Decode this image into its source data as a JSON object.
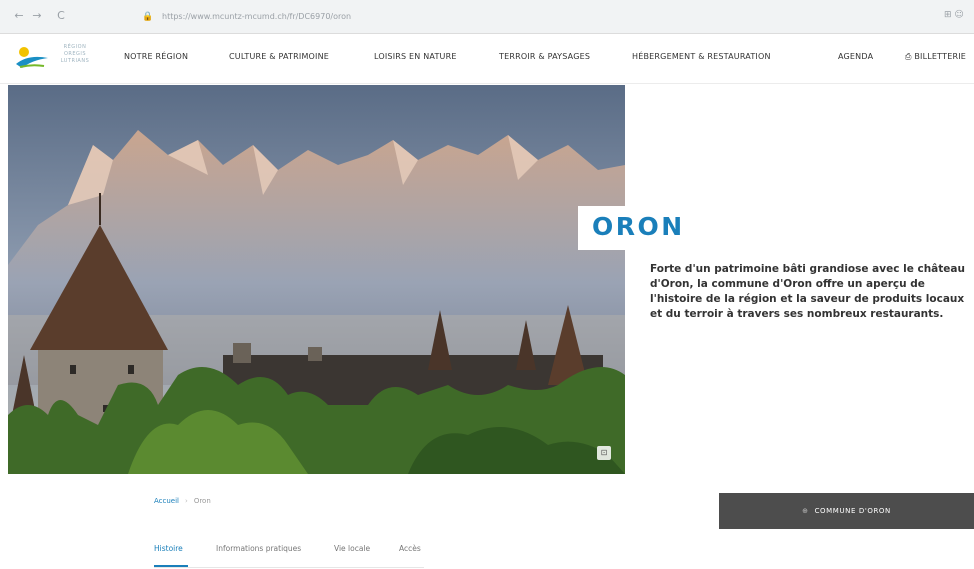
{
  "browser": {
    "url": "https://www.mcuntz-mcumd.ch/fr/DC6970/oron",
    "back_icon": "←",
    "forward_icon": "→",
    "reload_icon": "C",
    "lock_icon": "🔒",
    "right_icons": "⊞ ☺"
  },
  "header": {
    "logo_text": "RÉGION\nOREGIS\nLUTRIANS",
    "nav": [
      {
        "label": "NOTRE RÉGION"
      },
      {
        "label": "CULTURE & PATRIMOINE"
      },
      {
        "label": "LOISIRS EN NATURE"
      },
      {
        "label": "TERROIR & PAYSAGES"
      },
      {
        "label": "HÉBERGEMENT & RESTAURATION"
      },
      {
        "label": "AGENDA"
      },
      {
        "label": "⎙ BILLETTERIE"
      }
    ]
  },
  "hero": {
    "title": "ORON",
    "intro": "Forte d'un patrimoine bâti grandiose avec le château d'Oron, la commune d'Oron offre un aperçu de l'histoire de la région et la saveur de produits locaux et du terroir à travers ses nombreux restaurants."
  },
  "breadcrumb": {
    "home": "Accueil",
    "sep": "›",
    "current": "Oron"
  },
  "tabs": [
    {
      "label": "Histoire",
      "active": true
    },
    {
      "label": "Informations pratiques",
      "active": false
    },
    {
      "label": "Vie locale",
      "active": false
    },
    {
      "label": "Accès",
      "active": false
    }
  ],
  "commune_button": {
    "icon": "⊕",
    "label": "COMMUNE D'ORON"
  },
  "colors": {
    "accent": "#1a7fba",
    "button_bg": "#4d4d4d"
  }
}
